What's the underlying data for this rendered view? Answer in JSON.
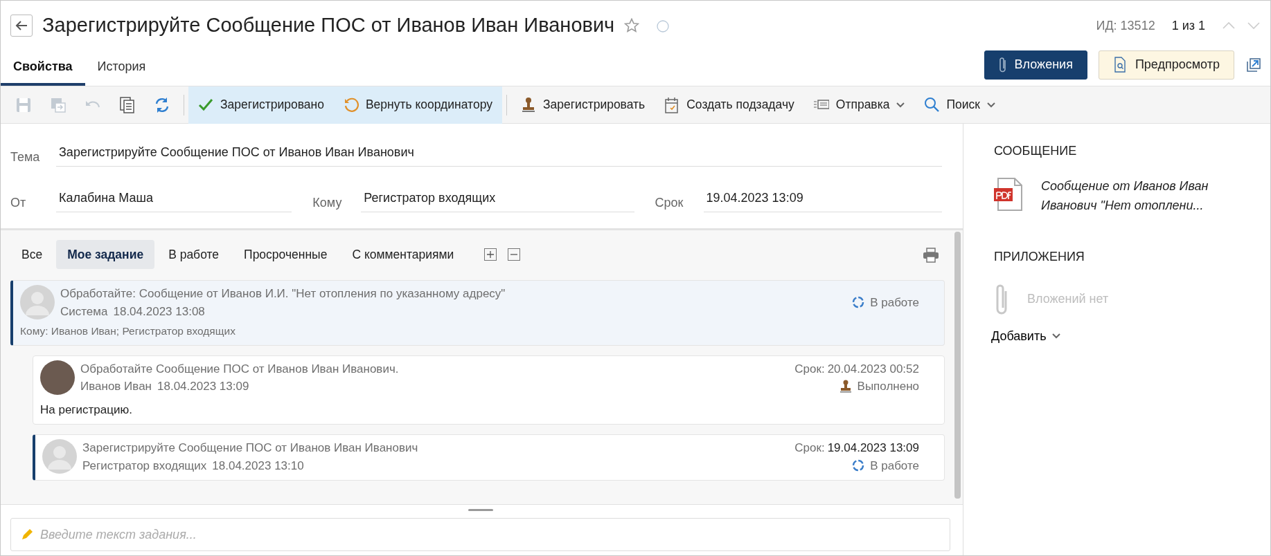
{
  "header": {
    "title": "Зарегистрируйте Сообщение ПОС от Иванов Иван Иванович",
    "favorite": false,
    "id_text": "ИД: 13512",
    "pager": "1 из 1"
  },
  "tabs": [
    {
      "label": "Свойства",
      "selected": true
    },
    {
      "label": "История",
      "selected": false
    }
  ],
  "header_buttons": [
    {
      "label": "Вложения",
      "kind": "primary"
    },
    {
      "label": "Предпросмотр",
      "kind": "preview"
    }
  ],
  "toolbar": {
    "icon_buttons": [
      {
        "disabled": true
      },
      {
        "disabled": true
      },
      {
        "disabled": true
      },
      {
        "disabled": false
      },
      {
        "disabled": false
      }
    ],
    "actions": [
      {
        "label": "Зарегистрировано",
        "highlighted": true,
        "dropdown": false
      },
      {
        "label": "Вернуть координатору",
        "highlighted": true,
        "dropdown": false
      },
      {
        "label": "Зарегистрировать",
        "highlighted": false,
        "dropdown": false
      },
      {
        "label": "Создать подзадачу",
        "highlighted": false,
        "dropdown": false
      },
      {
        "label": "Отправка",
        "highlighted": false,
        "dropdown": true
      },
      {
        "label": "Поиск",
        "highlighted": false,
        "dropdown": true
      }
    ]
  },
  "form": {
    "subject": {
      "label": "Тема",
      "value": "Зарегистрируйте Сообщение  ПОС от Иванов Иван Иванович"
    },
    "fields": [
      {
        "label": "От",
        "value": "Калабина Маша"
      },
      {
        "label": "Кому",
        "value": "Регистратор входящих"
      },
      {
        "label": "Срок",
        "value": "19.04.2023 13:09"
      }
    ]
  },
  "filters": [
    {
      "label": "Все",
      "selected": false
    },
    {
      "label": "Мое задание",
      "selected": true
    },
    {
      "label": "В работе",
      "selected": false
    },
    {
      "label": "Просроченные",
      "selected": false
    },
    {
      "label": "С комментариями",
      "selected": false
    }
  ],
  "tasks": [
    {
      "title": "Обработайте: Сообщение от Иванов И.И. \"Нет отопления по указанному адресу\"",
      "author": "Система",
      "date": "18.04.2023 13:08",
      "avatar": {
        "kind": "placeholder"
      },
      "status": {
        "kind": "in_progress",
        "label": "В работе"
      },
      "recipients": "Кому: Иванов Иван; Регистратор входящих",
      "selected": true,
      "marked": true,
      "children": [
        {
          "title": "Обработайте Сообщение ПОС от Иванов Иван Иванович.",
          "author": "Иванов Иван",
          "date": "18.04.2023 13:09",
          "avatar": {
            "kind": "photo"
          },
          "due_label": "Срок:",
          "due_value": "20.04.2023 00:52",
          "status": {
            "kind": "done",
            "label": "Выполнено"
          },
          "comment": "На регистрацию.",
          "selected": false,
          "marked": false
        },
        {
          "title": "Зарегистрируйте Сообщение ПОС от Иванов Иван Иванович",
          "author": "Регистратор входящих",
          "date": "18.04.2023 13:10",
          "avatar": {
            "kind": "placeholder"
          },
          "due_label": "Срок:",
          "due_value": "19.04.2023 13:09",
          "status": {
            "kind": "in_progress",
            "label": "В работе"
          },
          "selected": false,
          "marked": true
        }
      ]
    }
  ],
  "editor": {
    "placeholder": "Введите текст задания..."
  },
  "side": {
    "message_title": "СООБЩЕНИЕ",
    "document": "Сообщение от Иванов Иван Иванович \"Нет отоплени...",
    "attachments_title": "ПРИЛОЖЕНИЯ",
    "attachments_empty": "Вложений нет",
    "add_label": "Добавить"
  }
}
